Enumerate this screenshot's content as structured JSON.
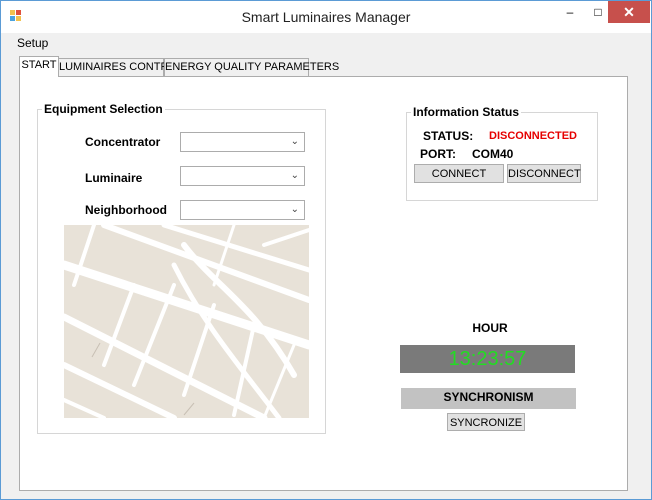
{
  "window": {
    "title": "Smart Luminaires Manager",
    "minimize_glyph": "–",
    "maximize_glyph": "□",
    "close_glyph": "✕"
  },
  "menu": {
    "items": [
      {
        "label": "Setup"
      }
    ]
  },
  "tabs": [
    {
      "label": "START",
      "active": true
    },
    {
      "label": "LUMINAIRES CONTROL",
      "active": false
    },
    {
      "label": "ENERGY QUALITY PARAMETERS",
      "active": false
    }
  ],
  "equipment": {
    "legend": "Equipment Selection",
    "concentrator_label": "Concentrator",
    "concentrator_value": "",
    "luminaire_label": "Luminaire",
    "luminaire_value": "",
    "neighborhood_label": "Neighborhood",
    "neighborhood_value": ""
  },
  "info": {
    "legend": "Information Status",
    "status_label": "STATUS:",
    "status_value": "DISCONNECTED",
    "port_label": "PORT:",
    "port_value": "COM40",
    "connect_label": "CONNECT",
    "disconnect_label": "DISCONNECT"
  },
  "clock": {
    "hour_label": "HOUR",
    "time": "13:23:57",
    "sync_label": "SYNCHRONISM",
    "sync_button": "SYNCRONIZE"
  },
  "colors": {
    "status_red": "#e60000",
    "clock_green": "#22dd22",
    "clock_bg": "#7a7a7a",
    "close_red": "#c7504c",
    "map_land": "#e8e2d8",
    "map_road": "#ffffff"
  },
  "icons": {
    "app": "app-icon",
    "dropdown": "chevron-down-icon",
    "close": "close-icon"
  }
}
